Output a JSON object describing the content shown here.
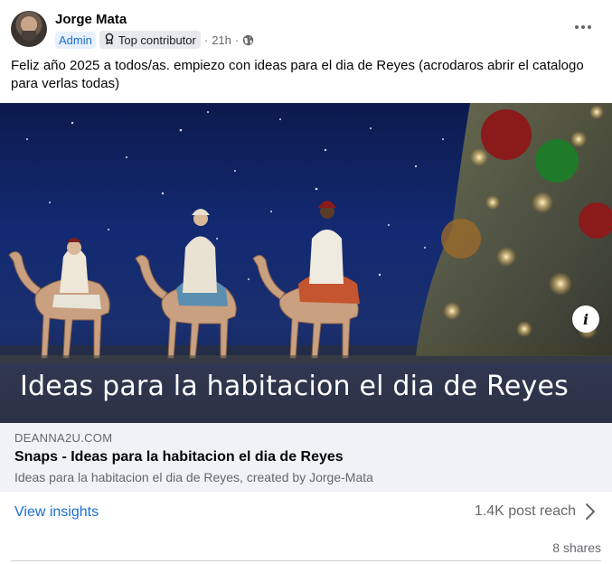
{
  "post": {
    "author": "Jorge Mata",
    "badges": {
      "admin": "Admin",
      "top_contributor": "Top contributor"
    },
    "separator": "·",
    "time": "21h",
    "message": "Feliz año 2025 a todos/as. empiezo con ideas para el dia de Reyes (acrodaros abrir el catalogo para verlas todas)"
  },
  "image": {
    "caption": "Ideas para la habitacion el dia de Reyes",
    "info_glyph": "i"
  },
  "link_preview": {
    "domain": "DEANNA2U.COM",
    "title": "Snaps - Ideas para la habitacion el dia de Reyes",
    "description": "Ideas para la habitacion el dia de Reyes, created by Jorge-Mata"
  },
  "footer": {
    "insights_label": "View insights",
    "reach_label": "1.4K post reach",
    "shares_label": "8 shares"
  },
  "colors": {
    "link_blue": "#1a6fd1",
    "secondary_text": "#65676b",
    "preview_bg": "#f0f2f5"
  },
  "icons": {
    "more": "more-horizontal-icon",
    "top_contributor": "award-icon",
    "audience": "globe-icon",
    "reach": "chevron-right-icon",
    "info": "info-icon"
  }
}
